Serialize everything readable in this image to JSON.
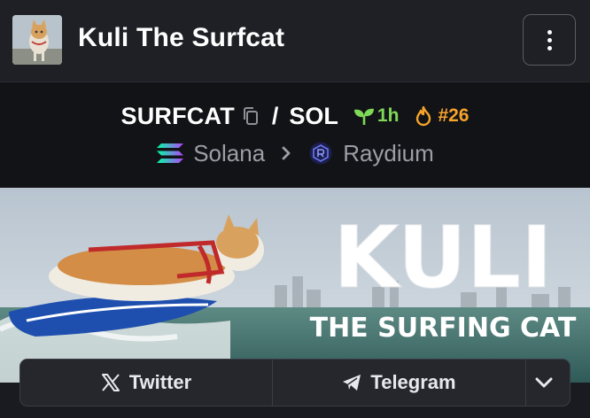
{
  "header": {
    "token_name": "Kuli The Surfcat",
    "avatar_icon": "cat-avatar-image",
    "menu_icon": "vertical-dots-icon"
  },
  "pair": {
    "base": "SURFCAT",
    "separator": "/",
    "quote": "SOL",
    "age": "1h",
    "rank": "#26",
    "age_color": "#7fd858",
    "rank_color": "#f6a32b"
  },
  "chain": {
    "network": "Solana",
    "dex": "Raydium"
  },
  "banner": {
    "title": "KULI",
    "subtitle": "THE SURFING CAT"
  },
  "links": {
    "twitter": "Twitter",
    "telegram": "Telegram"
  }
}
